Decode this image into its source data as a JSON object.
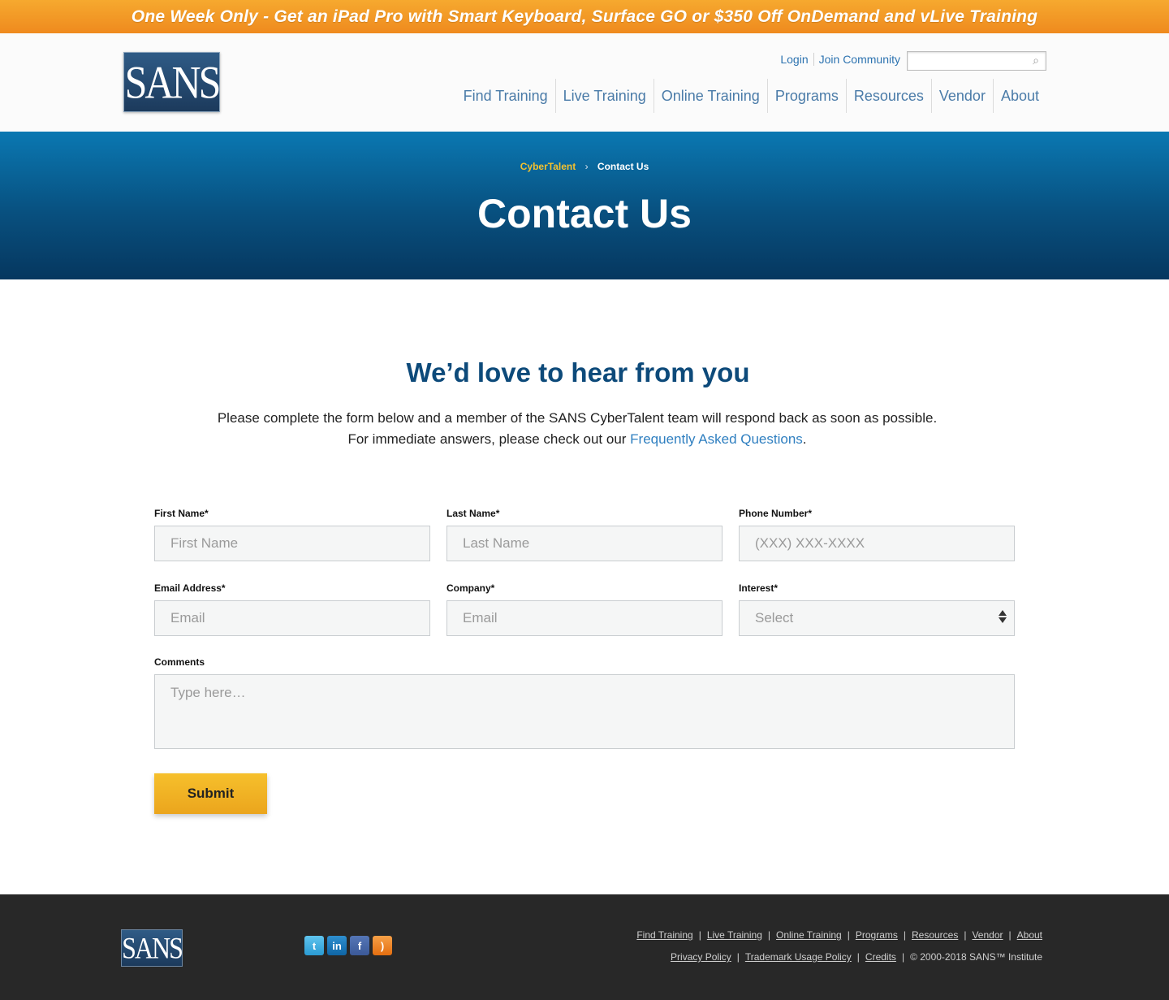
{
  "promo": {
    "text": "One Week Only - Get an iPad Pro with Smart Keyboard, Surface GO or $350 Off OnDemand and vLive Training"
  },
  "header": {
    "logo_text": "SANS",
    "utility": {
      "login": "Login",
      "join": "Join Community"
    },
    "nav": [
      "Find Training",
      "Live Training",
      "Online Training",
      "Programs",
      "Resources",
      "Vendor",
      "About"
    ]
  },
  "hero": {
    "breadcrumb": {
      "parent": "CyberTalent",
      "separator": "›",
      "current": "Contact Us"
    },
    "title": "Contact Us"
  },
  "intro": {
    "heading": "We’d love to hear from you",
    "line1": "Please complete the form below and a member of the SANS CyberTalent team will respond back as soon as possible.",
    "line2_prefix": "For immediate answers, please check out our ",
    "faq_link": "Frequently Asked Questions",
    "line2_suffix": "."
  },
  "form": {
    "first_name": {
      "label": "First Name*",
      "placeholder": "First Name"
    },
    "last_name": {
      "label": "Last Name*",
      "placeholder": "Last Name"
    },
    "phone": {
      "label": "Phone Number*",
      "placeholder": "(XXX) XXX-XXXX"
    },
    "email": {
      "label": "Email Address*",
      "placeholder": "Email"
    },
    "company": {
      "label": "Company*",
      "placeholder": "Email"
    },
    "interest": {
      "label": "Interest*",
      "value": "Select"
    },
    "comments": {
      "label": "Comments",
      "placeholder": "Type here…"
    },
    "submit": "Submit"
  },
  "footer": {
    "logo_text": "SANS",
    "social": [
      "twitter-icon",
      "linkedin-icon",
      "facebook-icon",
      "rss-icon"
    ],
    "nav": [
      "Find Training",
      "Live Training",
      "Online Training",
      "Programs",
      "Resources",
      "Vendor",
      "About"
    ],
    "legal": [
      "Privacy Policy",
      "Trademark Usage Policy",
      "Credits"
    ],
    "copyright": "© 2000-2018 SANS™ Institute"
  },
  "colors": {
    "accent": "#f4c12e",
    "brand_blue": "#0d4a7a",
    "link": "#2f7fc0",
    "promo": "#f29a26",
    "footer_bg": "#282828"
  }
}
